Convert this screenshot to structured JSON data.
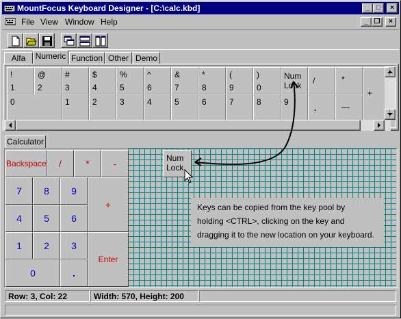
{
  "window": {
    "title": "MountFocus Keyboard Designer - [C:\\calc.kbd]",
    "controls": {
      "minimize": "_",
      "maximize": "□",
      "close": "×"
    },
    "mdi_controls": {
      "minimize": "_",
      "restore": "❐",
      "close": "×"
    }
  },
  "menu": {
    "items": [
      {
        "label": "File"
      },
      {
        "label": "View"
      },
      {
        "label": "Window"
      },
      {
        "label": "Help"
      }
    ]
  },
  "toolbar": {
    "buttons": [
      "new-file-icon",
      "open-folder-icon",
      "save-disk-icon",
      "cascade-icon",
      "tile-horizontal-icon",
      "tile-vertical-icon"
    ]
  },
  "pool_tabs": [
    {
      "label": "Alfa"
    },
    {
      "label": "Numeric"
    },
    {
      "label": "Function"
    },
    {
      "label": "Other"
    },
    {
      "label": "Demo"
    }
  ],
  "pool_keys_row1": [
    {
      "top": "!",
      "bottom": "1"
    },
    {
      "top": "@",
      "bottom": "2"
    },
    {
      "top": "#",
      "bottom": "3"
    },
    {
      "top": "$",
      "bottom": "4"
    },
    {
      "top": "%",
      "bottom": "5"
    },
    {
      "top": "^",
      "bottom": "6"
    },
    {
      "top": "&",
      "bottom": "7"
    },
    {
      "top": "*",
      "bottom": "8"
    },
    {
      "top": "(",
      "bottom": "9"
    },
    {
      "top": ")",
      "bottom": "0"
    }
  ],
  "pool_keys_row2": [
    "0",
    "1",
    "2",
    "3",
    "4",
    "5",
    "6",
    "7",
    "8",
    "9"
  ],
  "pool_special": {
    "numlock_line1": "Num",
    "numlock_line2": "Lock",
    "slash": "/",
    "star": "*",
    "plus": "+",
    "dot": ".",
    "minus": "—"
  },
  "calc_tab": {
    "label": "Calculator"
  },
  "calc_keys": {
    "backspace": "Backspace",
    "divide": "/",
    "multiply": "*",
    "subtract": "-",
    "seven": "7",
    "eight": "8",
    "nine": "9",
    "four": "4",
    "five": "5",
    "six": "6",
    "one": "1",
    "two": "2",
    "three": "3",
    "zero": "0",
    "decimal": ".",
    "add": "+",
    "enter": "Enter"
  },
  "dragged_key": {
    "line1": "Num",
    "line2": "Lock"
  },
  "info_text": {
    "line1": "Keys can be copied from the key pool by",
    "line2": "holding <CTRL>, clicking on the key and",
    "line3": "dragging it to the new location on your keyboard."
  },
  "status": {
    "position": "Row: 3, Col: 22",
    "size": "Width: 570, Height: 200"
  }
}
